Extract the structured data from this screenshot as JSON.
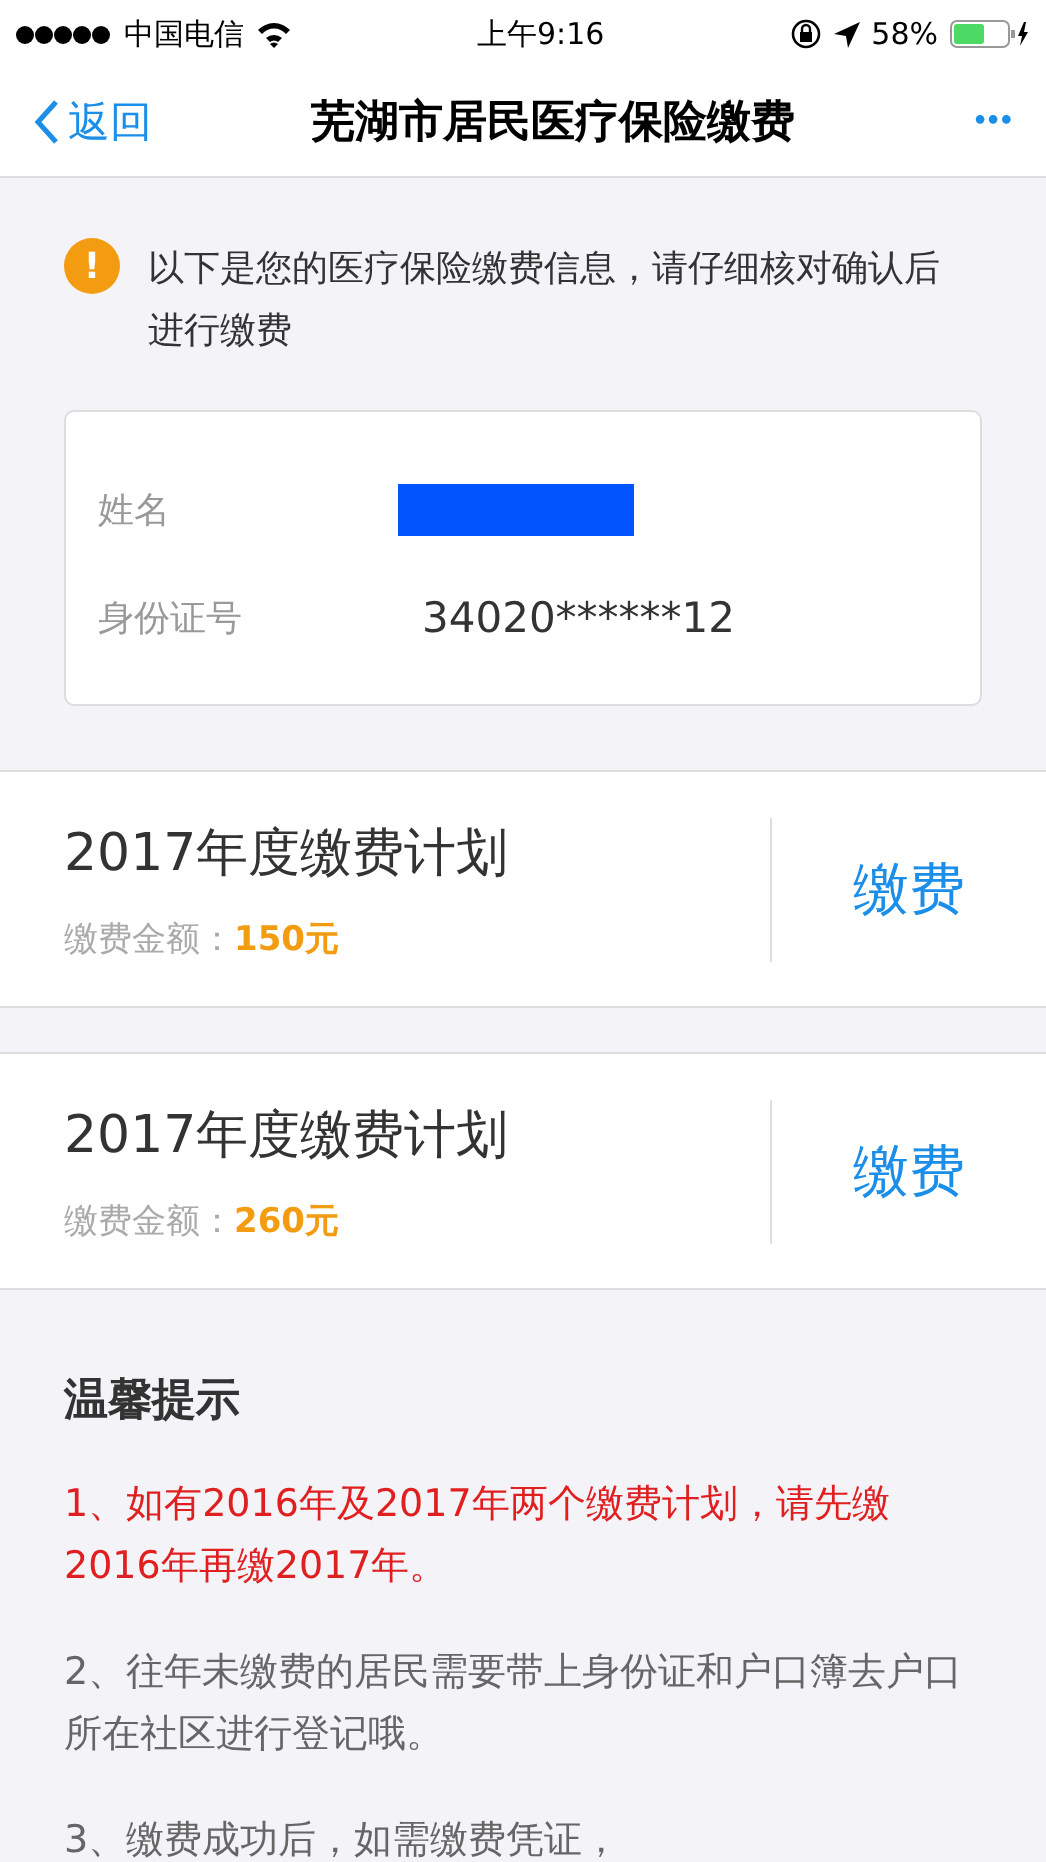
{
  "status_bar": {
    "carrier": "中国电信",
    "time": "上午9:16",
    "battery": "58%"
  },
  "nav": {
    "back": "返回",
    "title": "芜湖市居民医疗保险缴费",
    "more": "•••"
  },
  "notice": {
    "icon": "!",
    "text": "以下是您的医疗保险缴费信息，请仔细核对确认后进行缴费"
  },
  "info": [
    {
      "label": "姓名",
      "kind": "redacted"
    },
    {
      "label": "身份证号",
      "kind": "text",
      "value": "34020******12"
    }
  ],
  "plans": [
    {
      "title": "2017年度缴费计划",
      "amount_label": "缴费金额：",
      "amount": "150元",
      "button": "缴费"
    },
    {
      "title": "2017年度缴费计划",
      "amount_label": "缴费金额：",
      "amount": "260元",
      "button": "缴费"
    }
  ],
  "tips": {
    "title": "温馨提示",
    "items": [
      {
        "text": "1、如有2016年及2017年两个缴费计划，请先缴2016年再缴2017年。",
        "kind": "warning"
      },
      {
        "text": "2、往年未缴费的居民需要带上身份证和户口簿去户口所在社区进行登记哦。",
        "kind": "normal"
      },
      {
        "text": "3、缴费成功后，如需缴费凭证，",
        "kind": "normal"
      }
    ]
  }
}
